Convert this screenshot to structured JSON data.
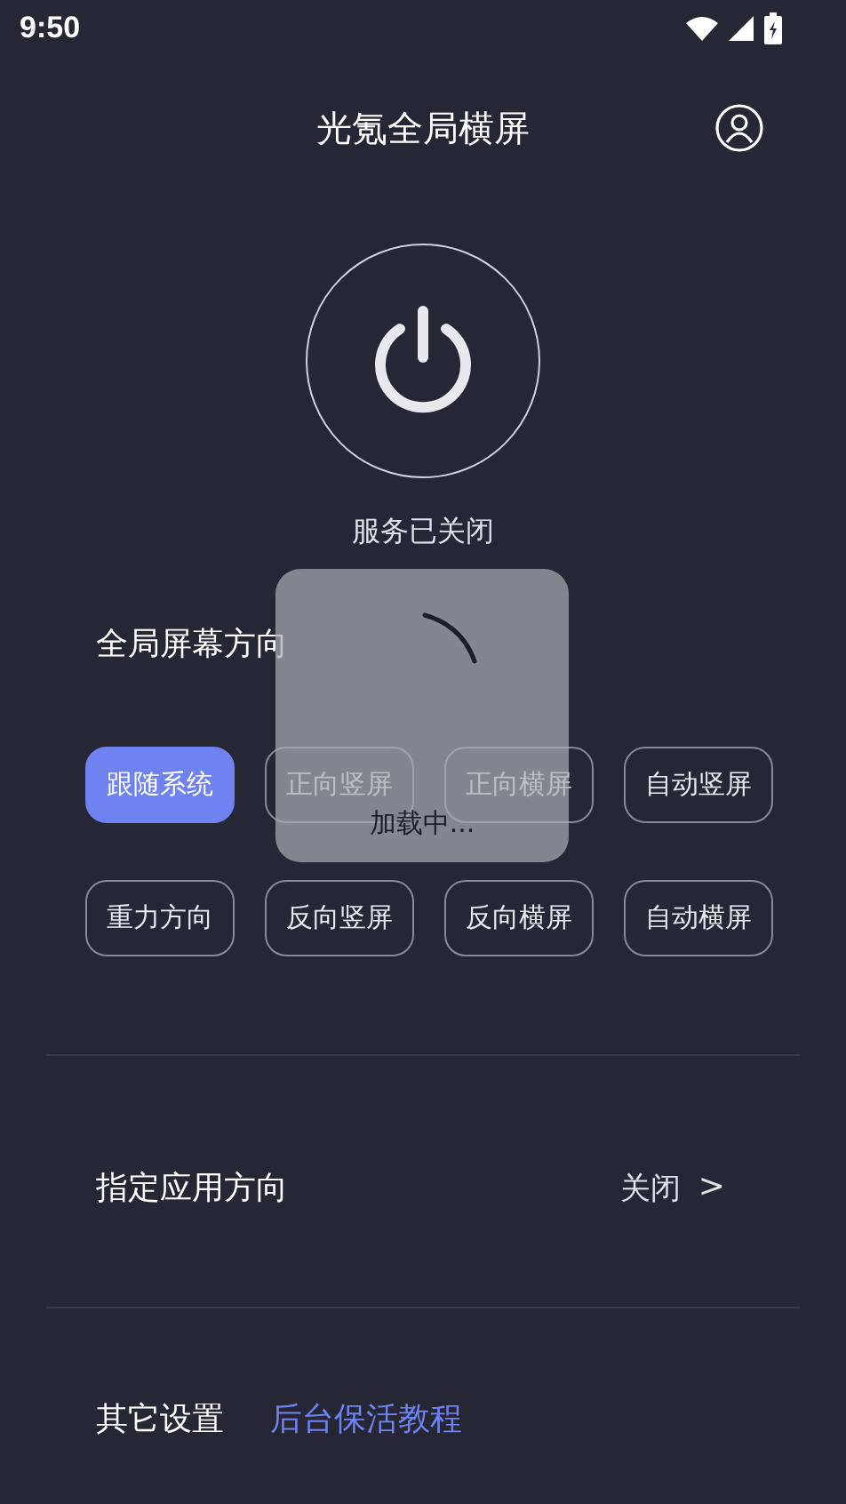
{
  "status_bar": {
    "time": "9:50"
  },
  "header": {
    "title": "光氪全局横屏"
  },
  "power": {
    "on": false,
    "status": "服务已关闭"
  },
  "orientation": {
    "title": "全局屏幕方向",
    "options": [
      {
        "label": "跟随系统",
        "selected": true
      },
      {
        "label": "正向竖屏",
        "selected": false
      },
      {
        "label": "正向横屏",
        "selected": false
      },
      {
        "label": "自动竖屏",
        "selected": false
      },
      {
        "label": "重力方向",
        "selected": false
      },
      {
        "label": "反向竖屏",
        "selected": false
      },
      {
        "label": "反向横屏",
        "selected": false
      },
      {
        "label": "自动横屏",
        "selected": false
      }
    ]
  },
  "app_orientation": {
    "label": "指定应用方向",
    "value": "关闭",
    "chevron": ">"
  },
  "other": {
    "label": "其它设置",
    "link": "后台保活教程"
  },
  "loading": {
    "text": "加载中..."
  }
}
